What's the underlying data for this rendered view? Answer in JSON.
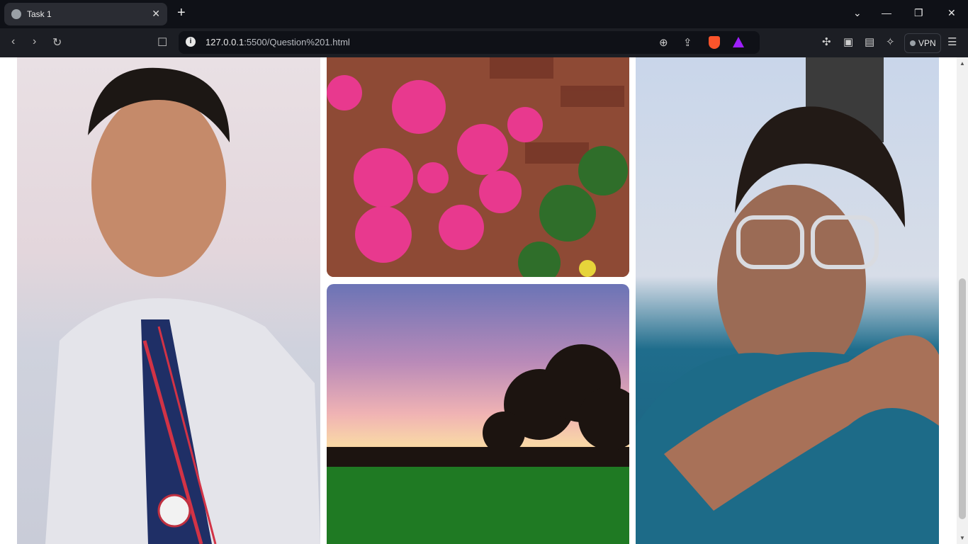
{
  "browser": {
    "tab_title": "Task 1",
    "new_tab_label": "+",
    "address_host": "127.0.0.1",
    "address_path": ":5500/Question%201.html",
    "vpn_label": "VPN"
  },
  "page": {
    "photos": [
      {
        "subject": "portrait of student in white shirt and striped tie"
      },
      {
        "subject": "pink roses against brick wall"
      },
      {
        "subject": "sunset sky over green field with trees"
      },
      {
        "subject": "selfie of young man with clear glasses and teal t-shirt"
      }
    ]
  },
  "colors": {
    "tabbar": "#0f1117",
    "toolbar": "#1c1e24",
    "brave_accent": "#fb542b"
  }
}
